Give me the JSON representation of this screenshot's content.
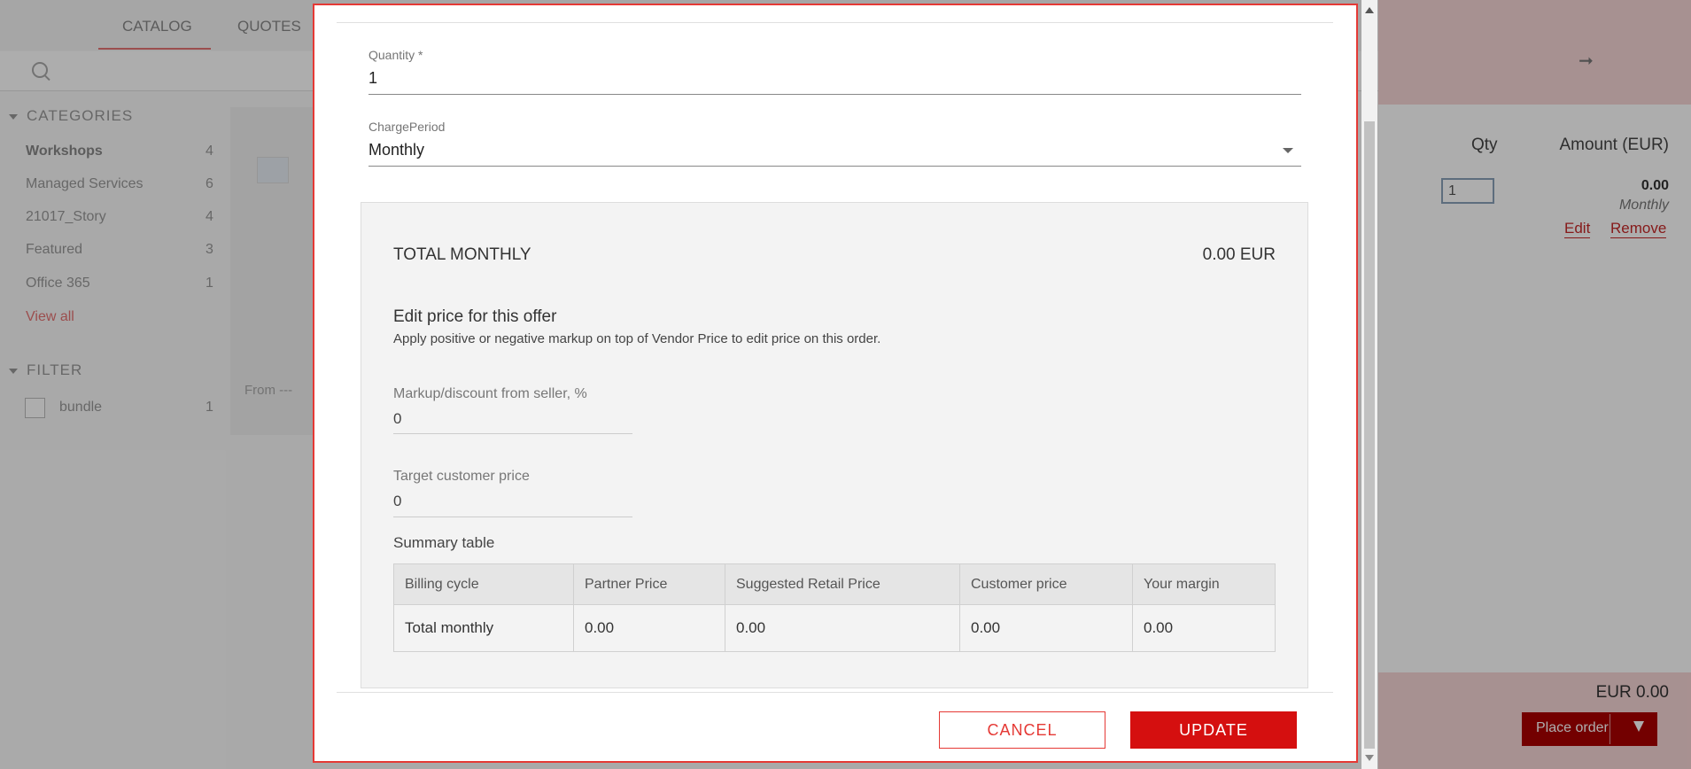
{
  "nav": {
    "tabs": [
      {
        "label": "CATALOG"
      },
      {
        "label": "QUOTES"
      }
    ]
  },
  "sidebar": {
    "categories_heading": "CATEGORIES",
    "categories": [
      {
        "label": "Workshops",
        "count": "4"
      },
      {
        "label": "Managed Services",
        "count": "6"
      },
      {
        "label": "21017_Story",
        "count": "4"
      },
      {
        "label": "Featured",
        "count": "3"
      },
      {
        "label": "Office 365",
        "count": "1"
      }
    ],
    "view_all": "View all",
    "filter_heading": "FILTER",
    "filter_items": [
      {
        "label": "bundle",
        "count": "1"
      }
    ]
  },
  "catalog": {
    "from_label": "From ---"
  },
  "cart": {
    "qty_header": "Qty",
    "amount_header": "Amount (EUR)",
    "qty_value": "1",
    "amount": "0.00",
    "period": "Monthly",
    "edit_link": "Edit",
    "remove_link": "Remove",
    "total": "EUR 0.00",
    "place_order": "Place order"
  },
  "modal": {
    "quantity_label": "Quantity *",
    "quantity_value": "1",
    "charge_period_label": "ChargePeriod",
    "charge_period_value": "Monthly",
    "total_label": "TOTAL MONTHLY",
    "total_value": "0.00 EUR",
    "edit_price_title": "Edit price for this offer",
    "edit_price_desc": "Apply positive or negative markup on top of Vendor Price to edit price on this order.",
    "markup_label": "Markup/discount from seller, %",
    "markup_value": "0",
    "target_label": "Target customer price",
    "target_value": "0",
    "summary_title": "Summary table",
    "summary_headers": [
      "Billing cycle",
      "Partner Price",
      "Suggested Retail Price",
      "Customer price",
      "Your margin"
    ],
    "summary_row": [
      "Total monthly",
      "0.00",
      "0.00",
      "0.00",
      "0.00"
    ],
    "cancel_label": "CANCEL",
    "update_label": "UPDATE"
  }
}
